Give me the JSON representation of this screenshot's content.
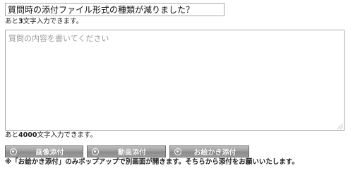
{
  "title_field": {
    "value": "質問時の添付ファイル形式の種類が減りました？"
  },
  "title_counter": {
    "prefix": "あと",
    "count": "3",
    "suffix": "文字入力できます。"
  },
  "body_field": {
    "placeholder": "質問の内容を書いてください",
    "value": ""
  },
  "body_counter": {
    "prefix": "あと",
    "count": "4000",
    "suffix": "文字入力できます。"
  },
  "attach_buttons": [
    {
      "label": "画像添付",
      "icon": "image-attach-icon"
    },
    {
      "label": "動画添付",
      "icon": "video-attach-icon"
    },
    {
      "label": "お絵かき添付",
      "icon": "drawing-attach-icon"
    }
  ],
  "note": "※「お絵かき添付」のみポップアップで別画面が開きます。そちらから添付をお願いいたします。",
  "colors": {
    "button_gradient_top": "#bdbdbd",
    "button_gradient_bottom": "#8a8a8a",
    "button_text": "#ffffff",
    "field_border": "#a9a9a9",
    "placeholder_text": "#9a9a9a"
  }
}
